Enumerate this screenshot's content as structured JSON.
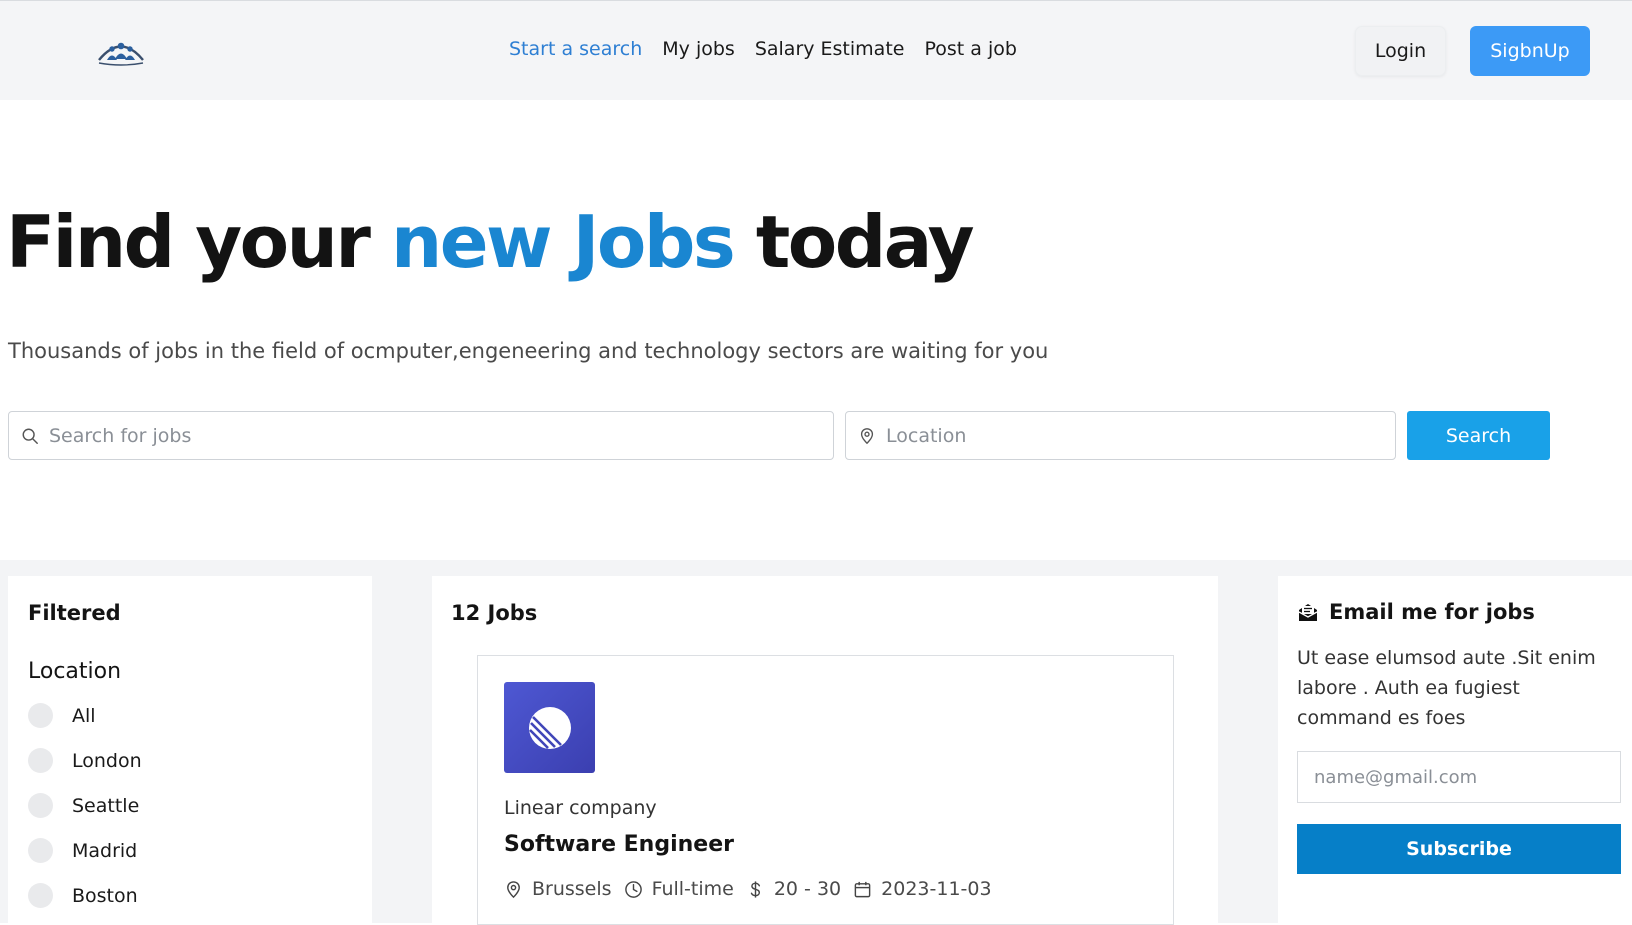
{
  "nav": {
    "items": [
      {
        "label": "Start a search",
        "active": true
      },
      {
        "label": "My jobs",
        "active": false
      },
      {
        "label": "Salary Estimate",
        "active": false
      },
      {
        "label": "Post a job",
        "active": false
      }
    ],
    "login_label": "Login",
    "signup_label": "SigbnUp"
  },
  "hero": {
    "title_part1": "Find your ",
    "title_accent": "new Jobs",
    "title_part2": " today",
    "subtitle": "Thousands of jobs in the field of ocmputer,engeneering and technology sectors are waiting for you"
  },
  "search": {
    "jobs_placeholder": "Search for jobs",
    "location_placeholder": "Location",
    "button_label": "Search"
  },
  "filters": {
    "title": "Filtered",
    "location_heading": "Location",
    "locations": [
      "All",
      "London",
      "Seattle",
      "Madrid",
      "Boston"
    ]
  },
  "jobs": {
    "count_label": "12 Jobs",
    "items": [
      {
        "company": "Linear company",
        "title": "Software Engineer",
        "location": "Brussels",
        "type": "Full-time",
        "salary": "20 - 30",
        "date": "2023-11-03"
      }
    ]
  },
  "email_alert": {
    "title": "Email me for jobs",
    "description": "Ut ease elumsod aute .Sit enim labore . Auth ea fugiest command es foes",
    "input_placeholder": "name@gmail.com",
    "button_label": "Subscribe"
  },
  "colors": {
    "accent": "#1a86d1",
    "nav_active": "#2e7fd3",
    "signup": "#3c9af6",
    "search_button": "#19a1e8",
    "subscribe_button": "#067fc8"
  }
}
